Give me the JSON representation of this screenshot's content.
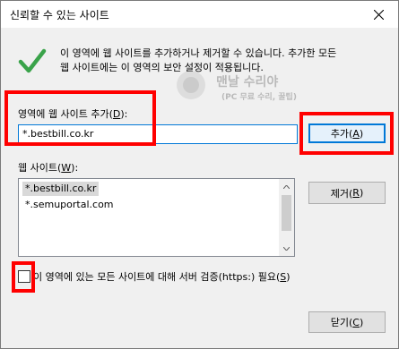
{
  "dialog": {
    "title": "신뢰할 수 있는 사이트",
    "info_line1": "이 영역에 웹 사이트를 추가하거나 제거할 수 있습니다. 추가한 모든",
    "info_line2": "웹 사이트에는 이 영역의 보안 설정이 적용됩니다."
  },
  "add_section": {
    "label_text": "영역에 웹 사이트 추가(",
    "label_key": "D",
    "label_end": "):",
    "input_value": "*.bestbill.co.kr",
    "add_button_text": "추가(",
    "add_button_key": "A",
    "add_button_end": ")"
  },
  "sites_section": {
    "label_text": "웹 사이트(",
    "label_key": "W",
    "label_end": "):",
    "items": [
      "*.bestbill.co.kr",
      "*.semuportal.com"
    ],
    "remove_button_text": "제거(",
    "remove_button_key": "R",
    "remove_button_end": ")"
  },
  "https": {
    "label_text": "이 영역에 있는 모든 사이트에 대해 서버 검증(https:) 필요(",
    "label_key": "S",
    "label_end": ")",
    "checked": false
  },
  "footer": {
    "close_button_text": "닫기(",
    "close_button_key": "C",
    "close_button_end": ")"
  },
  "watermark": {
    "title": "맨날 수리야",
    "subtitle": "(PC 무료 수리, 꿀팁)"
  },
  "icons": {
    "status": "checkmark-icon",
    "close": "close-icon"
  },
  "colors": {
    "highlight": "#ff0000",
    "checkmark": "#3aa34a",
    "focus": "#0078d7"
  }
}
